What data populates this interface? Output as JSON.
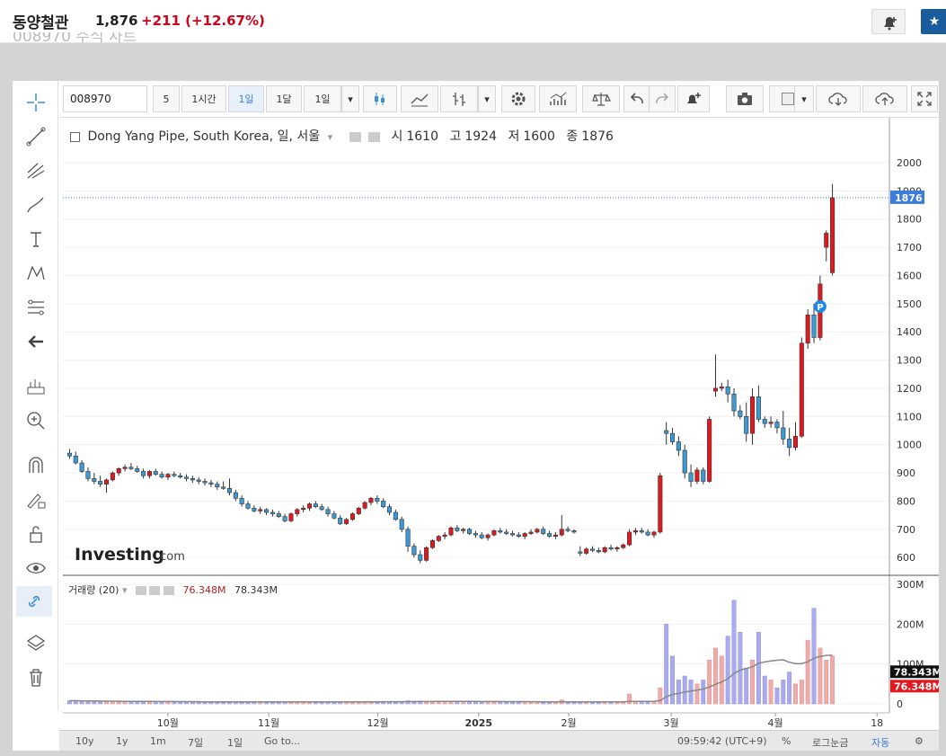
{
  "header": {
    "stock_name": "동양철관",
    "price": "1,876",
    "change": "+211",
    "change_pct": "(+12.67%)",
    "ghost_text": "008970 주식 차트"
  },
  "toolbar": {
    "symbol": "008970",
    "interval_5": "5",
    "interval_1h": "1시간",
    "interval_1d": "1일",
    "interval_1m": "1달",
    "interval_sel": "1일"
  },
  "legend": {
    "title": "Dong Yang Pipe, South Korea, 일, 서울",
    "open_label": "시",
    "open": "1610",
    "high_label": "고",
    "high": "1924",
    "low_label": "저",
    "low": "1600",
    "close_label": "종",
    "close": "1876"
  },
  "volume_legend": {
    "label": "거래량 (20)",
    "vol": "76.348M",
    "ma": "78.343M"
  },
  "watermark": {
    "brand": "Investing",
    "suffix": ".com"
  },
  "bottom": {
    "ranges": [
      "10y",
      "1y",
      "1m",
      "7일",
      "1일"
    ],
    "goto": "Go to...",
    "time": "09:59:42 (UTC+9)",
    "pct": "%",
    "log": "로그눈금",
    "auto": "자동"
  },
  "colors": {
    "up": "#e0191f",
    "down": "#3c9ad6",
    "accent": "#3b7dd8",
    "grid": "#f0f0f0"
  },
  "chart_data": {
    "type": "candlestick",
    "price_axis_ticks": [
      600,
      700,
      800,
      900,
      1000,
      1100,
      1200,
      1300,
      1400,
      1500,
      1600,
      1700,
      1800,
      1900,
      2000
    ],
    "price_ylim": [
      540,
      2070
    ],
    "last_price_label": "1876",
    "volume_axis_ticks": [
      "0",
      "100M",
      "200M",
      "300M"
    ],
    "volume_ylim": [
      0,
      300
    ],
    "volume_labels": {
      "vol": "76.348M",
      "ma": "78.343M"
    },
    "x_labels": [
      "10월",
      "11월",
      "12월",
      "2025",
      "2월",
      "3월",
      "4월",
      "18"
    ],
    "candles": [
      [
        970,
        985,
        950,
        960
      ],
      [
        960,
        975,
        930,
        935
      ],
      [
        935,
        945,
        900,
        905
      ],
      [
        905,
        920,
        870,
        880
      ],
      [
        880,
        900,
        860,
        870
      ],
      [
        870,
        890,
        850,
        860
      ],
      [
        860,
        880,
        830,
        875
      ],
      [
        875,
        905,
        870,
        900
      ],
      [
        900,
        920,
        890,
        915
      ],
      [
        915,
        930,
        905,
        920
      ],
      [
        920,
        935,
        910,
        915
      ],
      [
        915,
        925,
        900,
        905
      ],
      [
        905,
        915,
        880,
        890
      ],
      [
        890,
        910,
        880,
        905
      ],
      [
        905,
        915,
        890,
        895
      ],
      [
        895,
        905,
        880,
        885
      ],
      [
        885,
        900,
        875,
        895
      ],
      [
        895,
        905,
        885,
        890
      ],
      [
        890,
        900,
        880,
        885
      ],
      [
        885,
        895,
        870,
        880
      ],
      [
        880,
        890,
        865,
        875
      ],
      [
        875,
        885,
        860,
        870
      ],
      [
        870,
        880,
        855,
        865
      ],
      [
        865,
        875,
        850,
        860
      ],
      [
        860,
        870,
        840,
        850
      ],
      [
        850,
        870,
        840,
        845
      ],
      [
        845,
        880,
        820,
        830
      ],
      [
        830,
        840,
        800,
        810
      ],
      [
        810,
        820,
        780,
        790
      ],
      [
        790,
        800,
        770,
        775
      ],
      [
        775,
        785,
        760,
        765
      ],
      [
        765,
        780,
        755,
        770
      ],
      [
        770,
        775,
        750,
        760
      ],
      [
        760,
        770,
        745,
        755
      ],
      [
        755,
        765,
        740,
        745
      ],
      [
        745,
        755,
        725,
        730
      ],
      [
        730,
        760,
        725,
        755
      ],
      [
        755,
        775,
        745,
        770
      ],
      [
        770,
        785,
        760,
        775
      ],
      [
        775,
        795,
        765,
        790
      ],
      [
        790,
        800,
        775,
        780
      ],
      [
        780,
        790,
        765,
        770
      ],
      [
        770,
        780,
        745,
        755
      ],
      [
        755,
        765,
        735,
        740
      ],
      [
        740,
        750,
        715,
        720
      ],
      [
        720,
        740,
        715,
        735
      ],
      [
        735,
        760,
        730,
        755
      ],
      [
        755,
        780,
        750,
        775
      ],
      [
        775,
        800,
        770,
        795
      ],
      [
        795,
        815,
        785,
        810
      ],
      [
        810,
        820,
        790,
        800
      ],
      [
        800,
        810,
        775,
        780
      ],
      [
        780,
        790,
        750,
        760
      ],
      [
        760,
        770,
        730,
        735
      ],
      [
        735,
        745,
        690,
        700
      ],
      [
        700,
        710,
        620,
        640
      ],
      [
        640,
        650,
        600,
        610
      ],
      [
        610,
        625,
        580,
        590
      ],
      [
        590,
        640,
        585,
        635
      ],
      [
        635,
        665,
        630,
        660
      ],
      [
        660,
        680,
        655,
        675
      ],
      [
        675,
        690,
        665,
        680
      ],
      [
        680,
        710,
        675,
        705
      ],
      [
        705,
        715,
        690,
        695
      ],
      [
        695,
        705,
        685,
        700
      ],
      [
        700,
        705,
        680,
        685
      ],
      [
        685,
        695,
        670,
        680
      ],
      [
        680,
        690,
        665,
        670
      ],
      [
        670,
        685,
        660,
        680
      ],
      [
        680,
        700,
        675,
        695
      ],
      [
        695,
        705,
        685,
        690
      ],
      [
        690,
        700,
        680,
        685
      ],
      [
        685,
        695,
        675,
        680
      ],
      [
        680,
        690,
        670,
        675
      ],
      [
        675,
        690,
        665,
        685
      ],
      [
        685,
        700,
        680,
        690
      ],
      [
        690,
        705,
        685,
        700
      ],
      [
        700,
        710,
        680,
        685
      ],
      [
        685,
        695,
        670,
        675
      ],
      [
        675,
        690,
        665,
        680
      ],
      [
        680,
        750,
        675,
        700
      ],
      [
        700,
        710,
        690,
        695
      ],
      [
        695,
        700,
        685,
        690
      ],
      [
        620,
        640,
        605,
        615
      ],
      [
        615,
        635,
        610,
        630
      ],
      [
        630,
        640,
        620,
        625
      ],
      [
        625,
        635,
        615,
        620
      ],
      [
        620,
        640,
        615,
        635
      ],
      [
        635,
        645,
        625,
        630
      ],
      [
        630,
        640,
        620,
        635
      ],
      [
        635,
        650,
        630,
        645
      ],
      [
        645,
        700,
        640,
        690
      ],
      [
        690,
        705,
        680,
        695
      ],
      [
        695,
        705,
        685,
        690
      ],
      [
        690,
        700,
        675,
        680
      ],
      [
        680,
        695,
        670,
        690
      ],
      [
        690,
        900,
        685,
        890
      ],
      [
        1050,
        1080,
        1000,
        1040
      ],
      [
        1040,
        1060,
        1000,
        1010
      ],
      [
        1010,
        1030,
        960,
        980
      ],
      [
        980,
        1000,
        880,
        900
      ],
      [
        900,
        930,
        850,
        870
      ],
      [
        870,
        920,
        860,
        910
      ],
      [
        910,
        920,
        860,
        870
      ],
      [
        870,
        1100,
        865,
        1090
      ],
      [
        1190,
        1320,
        1170,
        1200
      ],
      [
        1200,
        1220,
        1190,
        1205
      ],
      [
        1205,
        1230,
        1150,
        1180
      ],
      [
        1180,
        1200,
        1100,
        1120
      ],
      [
        1120,
        1140,
        1090,
        1100
      ],
      [
        1100,
        1150,
        1010,
        1040
      ],
      [
        1040,
        1200,
        1000,
        1170
      ],
      [
        1170,
        1210,
        1080,
        1090
      ],
      [
        1090,
        1100,
        1060,
        1075
      ],
      [
        1075,
        1100,
        1060,
        1080
      ],
      [
        1080,
        1090,
        1040,
        1060
      ],
      [
        1060,
        1120,
        1000,
        1020
      ],
      [
        1020,
        1060,
        960,
        990
      ],
      [
        990,
        1080,
        980,
        1030
      ],
      [
        1030,
        1380,
        1025,
        1360
      ],
      [
        1360,
        1480,
        1340,
        1460
      ],
      [
        1460,
        1500,
        1360,
        1380
      ],
      [
        1380,
        1600,
        1370,
        1570
      ],
      [
        1700,
        1760,
        1650,
        1750
      ],
      [
        1610,
        1924,
        1600,
        1876
      ]
    ],
    "volumes": [
      8,
      8,
      7,
      7,
      6,
      6,
      6,
      6,
      5,
      5,
      5,
      5,
      5,
      5,
      5,
      5,
      5,
      5,
      5,
      5,
      5,
      5,
      5,
      5,
      5,
      5,
      5,
      5,
      5,
      5,
      5,
      5,
      5,
      5,
      5,
      5,
      5,
      5,
      5,
      5,
      5,
      5,
      5,
      5,
      5,
      6,
      6,
      6,
      6,
      6,
      6,
      6,
      6,
      6,
      6,
      8,
      7,
      7,
      6,
      6,
      6,
      6,
      6,
      5,
      5,
      5,
      5,
      5,
      5,
      5,
      5,
      5,
      5,
      5,
      5,
      5,
      5,
      5,
      5,
      5,
      10,
      5,
      5,
      5,
      5,
      5,
      5,
      5,
      5,
      5,
      5,
      25,
      6,
      6,
      6,
      6,
      40,
      200,
      120,
      60,
      70,
      60,
      50,
      60,
      110,
      140,
      120,
      170,
      260,
      180,
      90,
      110,
      180,
      70,
      60,
      40,
      60,
      80,
      50,
      60,
      160,
      240,
      140,
      110,
      120
    ]
  }
}
